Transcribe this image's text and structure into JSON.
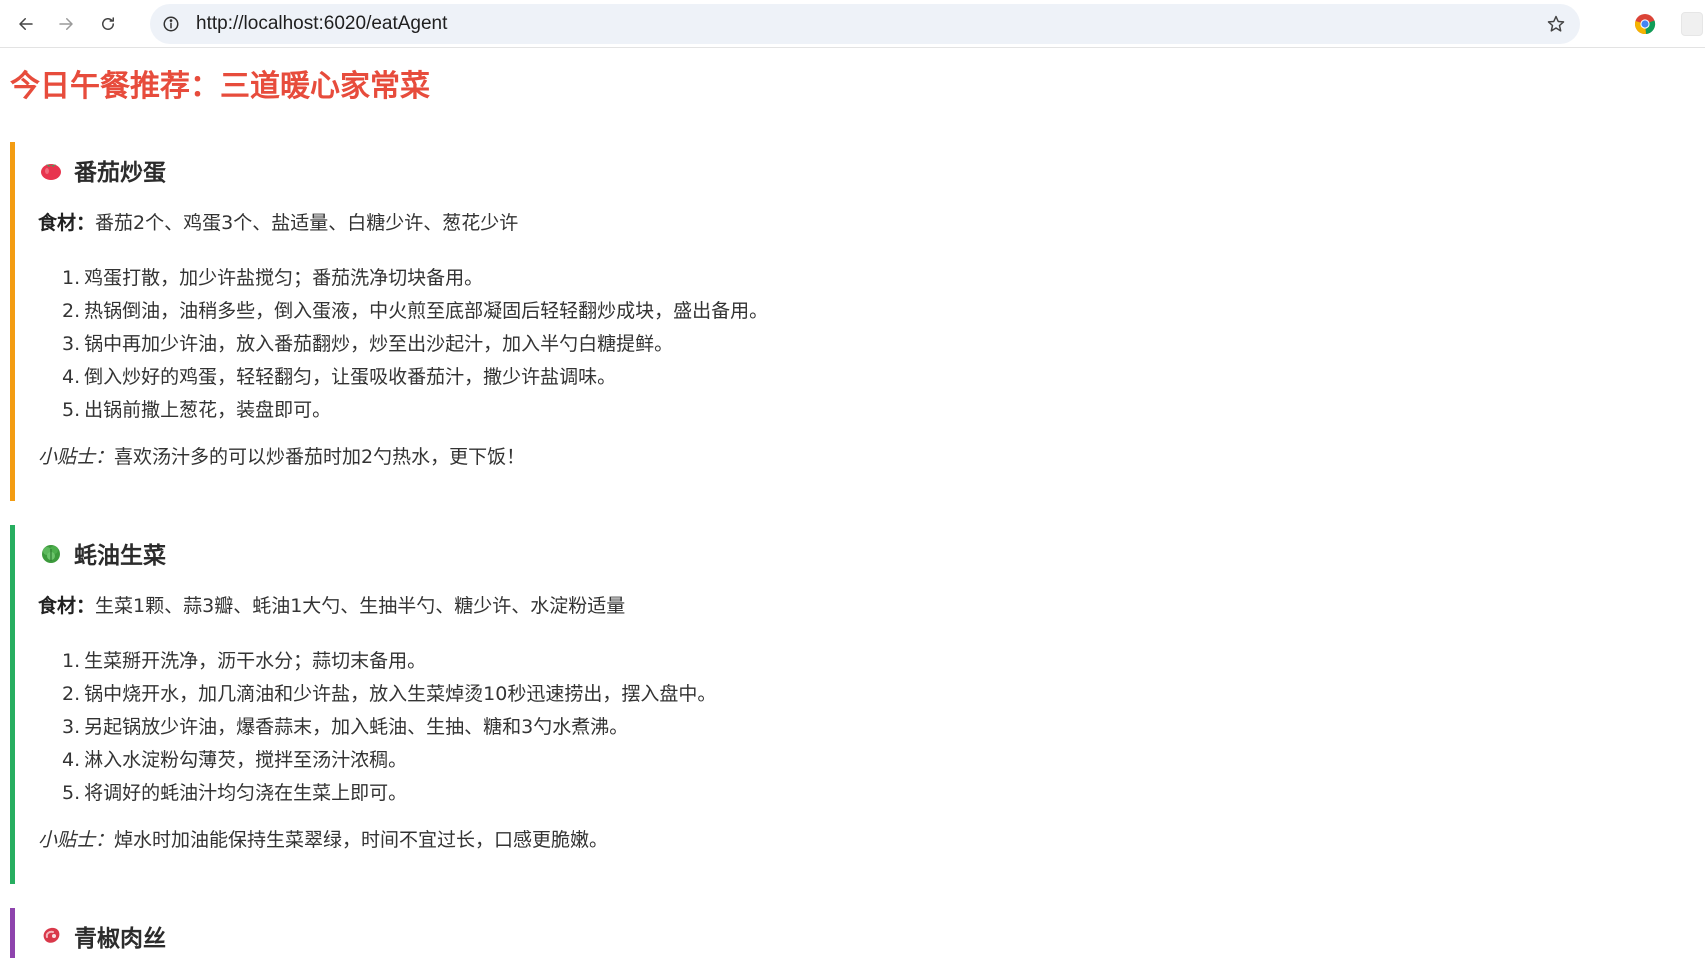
{
  "browser": {
    "url": "http://localhost:6020/eatAgent",
    "back_icon": "back-arrow-icon",
    "forward_icon": "forward-arrow-icon",
    "reload_icon": "reload-icon",
    "info_icon": "info-icon",
    "bookmark_icon": "star-icon",
    "extension_icon": "chrome-logo-icon"
  },
  "page": {
    "title": "今日午餐推荐：三道暖心家常菜"
  },
  "recipes": [
    {
      "icon": "tomato-icon",
      "accent": "#f39c12",
      "name": "番茄炒蛋",
      "ingredients_label": "食材：",
      "ingredients": "番茄2个、鸡蛋3个、盐适量、白糖少许、葱花少许",
      "steps": [
        {
          "num": "1.",
          "text": "鸡蛋打散，加少许盐搅匀；番茄洗净切块备用。"
        },
        {
          "num": "2.",
          "text": "热锅倒油，油稍多些，倒入蛋液，中火煎至底部凝固后轻轻翻炒成块，盛出备用。"
        },
        {
          "num": "3.",
          "text": "锅中再加少许油，放入番茄翻炒，炒至出沙起汁，加入半勺白糖提鲜。"
        },
        {
          "num": "4.",
          "text": "倒入炒好的鸡蛋，轻轻翻匀，让蛋吸收番茄汁，撒少许盐调味。"
        },
        {
          "num": "5.",
          "text": "出锅前撒上葱花，装盘即可。"
        }
      ],
      "tip_label": "小贴士：",
      "tip": "喜欢汤汁多的可以炒番茄时加2勺热水，更下饭！"
    },
    {
      "icon": "lettuce-icon",
      "accent": "#27ae60",
      "name": "蚝油生菜",
      "ingredients_label": "食材：",
      "ingredients": "生菜1颗、蒜3瓣、蚝油1大勺、生抽半勺、糖少许、水淀粉适量",
      "steps": [
        {
          "num": "1.",
          "text": "生菜掰开洗净，沥干水分；蒜切末备用。"
        },
        {
          "num": "2.",
          "text": "锅中烧开水，加几滴油和少许盐，放入生菜焯烫10秒迅速捞出，摆入盘中。"
        },
        {
          "num": "3.",
          "text": "另起锅放少许油，爆香蒜末，加入蚝油、生抽、糖和3勺水煮沸。"
        },
        {
          "num": "4.",
          "text": "淋入水淀粉勾薄芡，搅拌至汤汁浓稠。"
        },
        {
          "num": "5.",
          "text": "将调好的蚝油汁均匀浇在生菜上即可。"
        }
      ],
      "tip_label": "小贴士：",
      "tip": "焯水时加油能保持生菜翠绿，时间不宜过长，口感更脆嫩。"
    },
    {
      "icon": "meat-icon",
      "accent": "#8e44ad",
      "name": "青椒肉丝"
    }
  ]
}
